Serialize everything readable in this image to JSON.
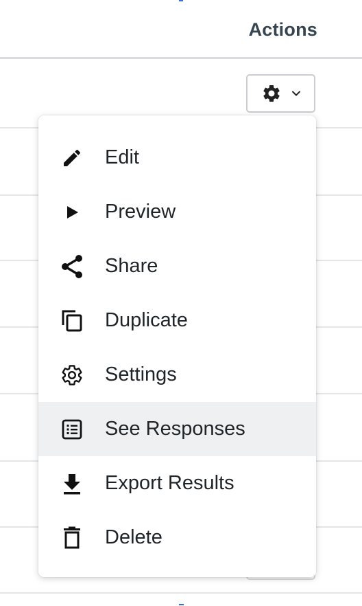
{
  "table": {
    "actions_header": "Actions"
  },
  "action_menu": {
    "trigger_icon": "gear-icon",
    "trigger_caret_icon": "chevron-down-icon",
    "items": [
      {
        "label": "Edit",
        "icon": "pencil-icon",
        "highlighted": false
      },
      {
        "label": "Preview",
        "icon": "play-icon",
        "highlighted": false
      },
      {
        "label": "Share",
        "icon": "share-icon",
        "highlighted": false
      },
      {
        "label": "Duplicate",
        "icon": "duplicate-icon",
        "highlighted": false
      },
      {
        "label": "Settings",
        "icon": "gear-outline-icon",
        "highlighted": false
      },
      {
        "label": "See Responses",
        "icon": "list-icon",
        "highlighted": true
      },
      {
        "label": "Export Results",
        "icon": "download-icon",
        "highlighted": false
      },
      {
        "label": "Delete",
        "icon": "trash-icon",
        "highlighted": false
      }
    ]
  },
  "colors": {
    "header_text": "#36454f",
    "highlight_bg": "#eef0f2",
    "icon_color": "#111111"
  }
}
